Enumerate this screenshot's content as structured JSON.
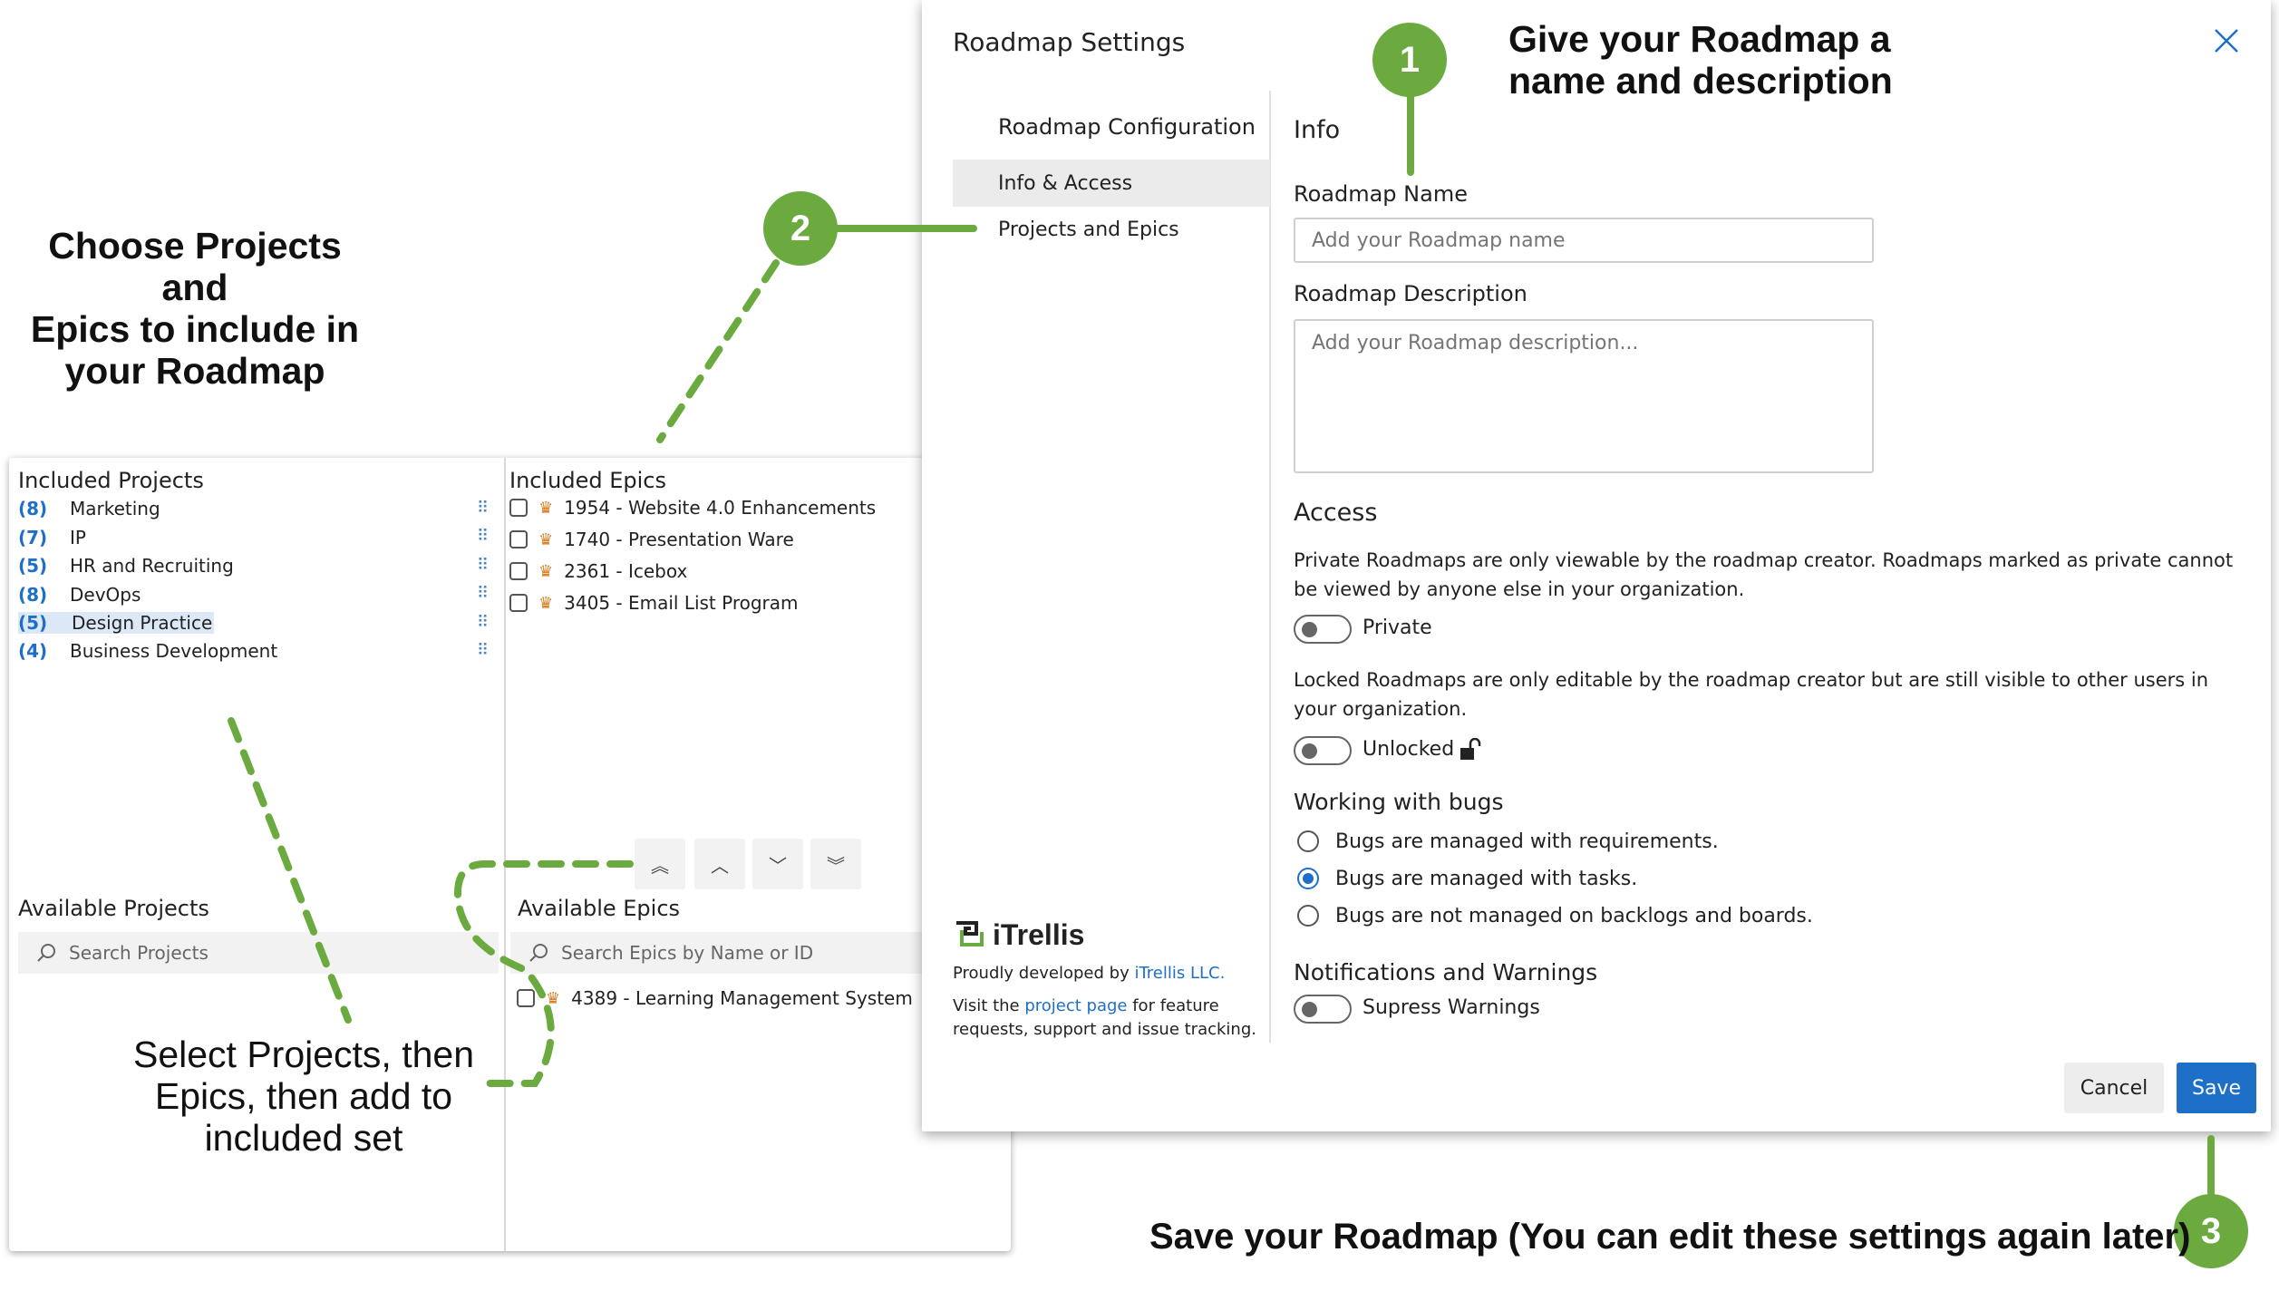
{
  "annotations": {
    "step1_number": "1",
    "step1_text_line1": "Give your Roadmap a",
    "step1_text_line2": "name and description",
    "step2_number": "2",
    "step2_text_line1": "Choose Projects and",
    "step2_text_line2": "Epics to include in",
    "step2_text_line3": "your Roadmap",
    "select_text_line1": "Select Projects, then",
    "select_text_line2": "Epics, then add to",
    "select_text_line3": "included set",
    "step3_number": "3",
    "step3_text": "Save your Roadmap (You can edit these settings again later)",
    "accent_color": "#6aaa3f"
  },
  "projects": {
    "included_title": "Included Projects",
    "included": [
      {
        "count": "(8)",
        "name": "Marketing"
      },
      {
        "count": "(7)",
        "name": "IP"
      },
      {
        "count": "(5)",
        "name": "HR and Recruiting"
      },
      {
        "count": "(8)",
        "name": "DevOps"
      },
      {
        "count": "(5)",
        "name": "Design Practice"
      },
      {
        "count": "(4)",
        "name": "Business Development"
      }
    ],
    "available_title": "Available Projects",
    "search_placeholder": "Search Projects"
  },
  "epics": {
    "included_title": "Included Epics",
    "included": [
      {
        "label": "1954 - Website 4.0 Enhancements"
      },
      {
        "label": "1740 - Presentation Ware"
      },
      {
        "label": "2361 - Icebox"
      },
      {
        "label": "3405 - Email List Program"
      }
    ],
    "available_title": "Available Epics",
    "search_placeholder": "Search Epics by Name or ID",
    "available": [
      {
        "label": "4389 - Learning Management System"
      }
    ],
    "move_buttons": [
      "move-top",
      "move-up",
      "move-down",
      "move-bottom"
    ]
  },
  "dialog": {
    "title": "Roadmap Settings",
    "nav_heading": "Roadmap Configuration",
    "nav_items": [
      "Info & Access",
      "Projects and Epics"
    ],
    "info_heading": "Info",
    "name_label": "Roadmap Name",
    "name_placeholder": "Add your Roadmap name",
    "desc_label": "Roadmap Description",
    "desc_placeholder": "Add your Roadmap description...",
    "access_heading": "Access",
    "private_text": "Private Roadmaps are only viewable by the roadmap creator. Roadmaps marked as private cannot be viewed by anyone else in your organization.",
    "private_toggle_label": "Private",
    "locked_text": "Locked Roadmaps are only editable by the roadmap creator but are still visible to other users in your organization.",
    "locked_toggle_label": "Unlocked",
    "bugs_heading": "Working with bugs",
    "bug_options": [
      "Bugs are managed with requirements.",
      "Bugs are managed with tasks.",
      "Bugs are not managed on backlogs and boards."
    ],
    "bug_selected_index": 1,
    "notif_heading": "Notifications and Warnings",
    "warnings_toggle_label": "Supress Warnings",
    "cancel_label": "Cancel",
    "save_label": "Save",
    "primary_color": "#1e6fc8"
  },
  "branding": {
    "logo_text": "iTrellis",
    "line1_prefix": "Proudly developed by ",
    "line1_link": "iTrellis LLC.",
    "line2_prefix": "Visit the ",
    "line2_link": "project page",
    "line2_suffix": " for feature",
    "line3": "requests, support and issue tracking."
  }
}
